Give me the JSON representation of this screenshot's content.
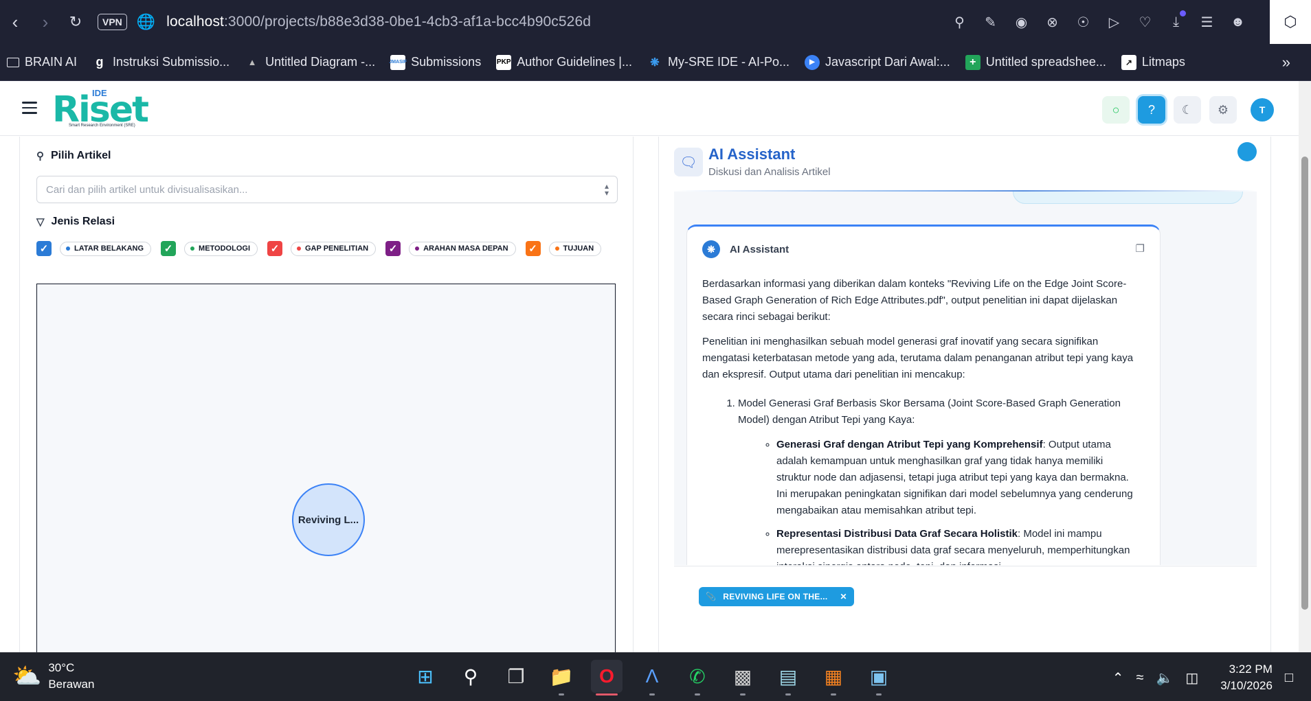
{
  "browser": {
    "url_host": "localhost",
    "url_rest": ":3000/projects/b88e3d38-0be1-4cb3-af1a-bcc4b90c526d",
    "vpn_label": "VPN",
    "bookmarks": [
      {
        "label": "BRAIN AI",
        "icon": "folder-icon",
        "color": "#1f2233"
      },
      {
        "label": "Instruksi Submissio...",
        "icon": "g-icon",
        "color": "#1f2233"
      },
      {
        "label": "Untitled Diagram -...",
        "icon": "diagram-icon",
        "color": "#1f2233"
      },
      {
        "label": "Submissions",
        "icon": "jmasif-icon",
        "color": "#ffffff"
      },
      {
        "label": "Author Guidelines |...",
        "icon": "pkp-icon",
        "color": "#ffffff"
      },
      {
        "label": "My-SRE IDE - AI-Po...",
        "icon": "sre-icon",
        "color": "#1f2233"
      },
      {
        "label": "Javascript Dari Awal:...",
        "icon": "play-icon",
        "color": "#3b82f6"
      },
      {
        "label": "Untitled spreadshee...",
        "icon": "sheets-icon",
        "color": "#22a55a"
      },
      {
        "label": "Litmaps",
        "icon": "litmaps-icon",
        "color": "#ffffff"
      }
    ]
  },
  "app": {
    "logo_main": "Riset",
    "logo_ide": "IDE",
    "logo_tagline": "Smart Research Environment (SRE)",
    "avatar_initial": "T",
    "colors": {
      "accent": "#1e9be0",
      "logo": "#1ab8a7",
      "title": "#2563c9"
    }
  },
  "left": {
    "article_section_title": "Pilih Artikel",
    "article_placeholder": "Cari dan pilih artikel untuk divisualisasikan...",
    "relation_section_title": "Jenis Relasi",
    "relations": [
      {
        "label": "LATAR BELAKANG",
        "color": "#2b7bd6",
        "checked": true
      },
      {
        "label": "METODOLOGI",
        "color": "#22a55a",
        "checked": true
      },
      {
        "label": "GAP PENELITIAN",
        "color": "#ef4444",
        "checked": true
      },
      {
        "label": "ARAHAN MASA DEPAN",
        "color": "#7e1f86",
        "checked": true
      },
      {
        "label": "TUJUAN",
        "color": "#f97316",
        "checked": true
      }
    ],
    "graph_node_label": "Reviving L..."
  },
  "right": {
    "title": "AI Assistant",
    "subtitle": "Diskusi dan Analisis Artikel",
    "message": {
      "author": "AI Assistant",
      "p1": "Berdasarkan informasi yang diberikan dalam konteks \"Reviving Life on the Edge Joint Score-Based Graph Generation of Rich Edge Attributes.pdf\", output penelitian ini dapat dijelaskan secara rinci sebagai berikut:",
      "p2": "Penelitian ini menghasilkan sebuah model generasi graf inovatif yang secara signifikan mengatasi keterbatasan metode yang ada, terutama dalam penanganan atribut tepi yang kaya dan ekspresif. Output utama dari penelitian ini mencakup:",
      "li1": "Model Generasi Graf Berbasis Skor Bersama (Joint Score-Based Graph Generation Model) dengan Atribut Tepi yang Kaya:",
      "sub1_bold": "Generasi Graf dengan Atribut Tepi yang Komprehensif",
      "sub1_text": ": Output utama adalah kemampuan untuk menghasilkan graf yang tidak hanya memiliki struktur node dan adjasensi, tetapi juga atribut tepi yang kaya dan bermakna. Ini merupakan peningkatan signifikan dari model sebelumnya yang cenderung mengabaikan atau memisahkan atribut tepi.",
      "sub2_bold": "Representasi Distribusi Data Graf Secara Holistik",
      "sub2_text": ": Model ini mampu merepresentasikan distribusi data graf secara menyeluruh, memperhitungkan interaksi sinergis antara node, tepi, dan informasi"
    },
    "context_chip": "REVIVING LIFE ON THE..."
  },
  "taskbar": {
    "temperature": "30°C",
    "weather": "Berawan",
    "time": "3:22 PM",
    "date": "3/10/2026"
  }
}
